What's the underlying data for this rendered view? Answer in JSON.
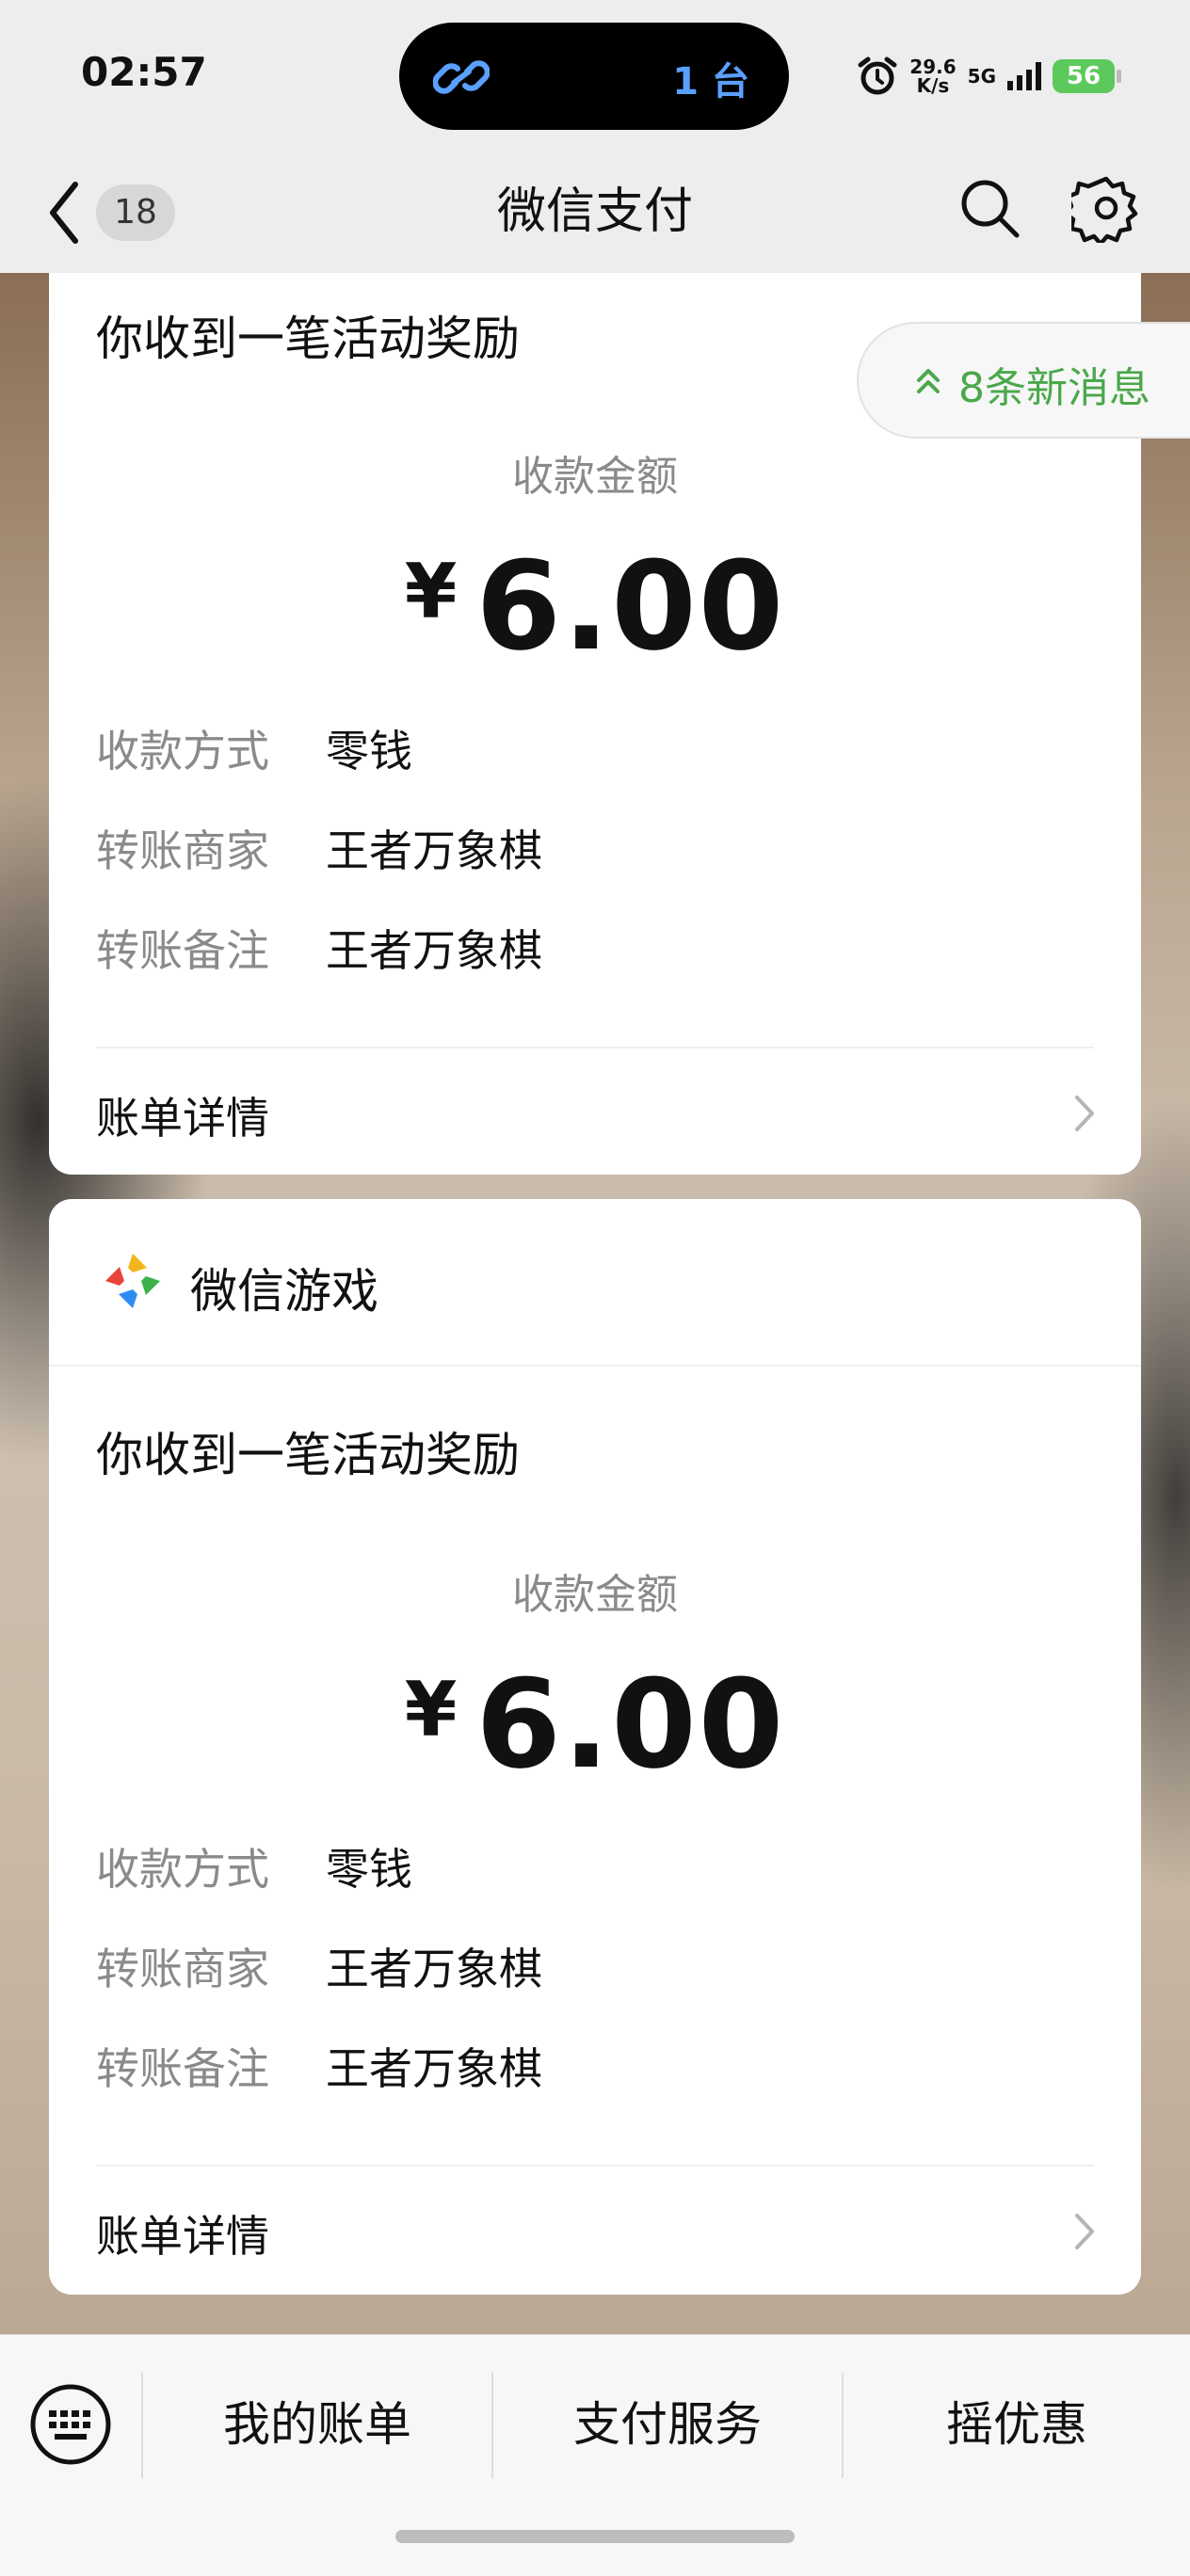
{
  "status_bar": {
    "time": "02:57",
    "island_text": "1 台",
    "net_speed_top": "29.6",
    "net_speed_bottom": "K/s",
    "network": "5G",
    "battery": "56"
  },
  "nav": {
    "unread_count": "18",
    "title": "微信支付"
  },
  "new_messages": "8条新消息",
  "cards": [
    {
      "title": "你收到一笔活动奖励",
      "amount_label": "收款金额",
      "currency": "¥",
      "amount": "6.00",
      "rows": [
        {
          "label": "收款方式",
          "value": "零钱"
        },
        {
          "label": "转账商家",
          "value": "王者万象棋"
        },
        {
          "label": "转账备注",
          "value": "王者万象棋"
        }
      ],
      "detail_link": "账单详情"
    },
    {
      "sender": "微信游戏",
      "title": "你收到一笔活动奖励",
      "amount_label": "收款金额",
      "currency": "¥",
      "amount": "6.00",
      "rows": [
        {
          "label": "收款方式",
          "value": "零钱"
        },
        {
          "label": "转账商家",
          "value": "王者万象棋"
        },
        {
          "label": "转账备注",
          "value": "王者万象棋"
        }
      ],
      "detail_link": "账单详情"
    }
  ],
  "bottom_menu": {
    "items": [
      "我的账单",
      "支付服务",
      "摇优惠"
    ]
  },
  "colors": {
    "accent_green": "#4aa84a",
    "battery_green": "#5bc95b",
    "island_text_blue": "#5aa0ff"
  }
}
